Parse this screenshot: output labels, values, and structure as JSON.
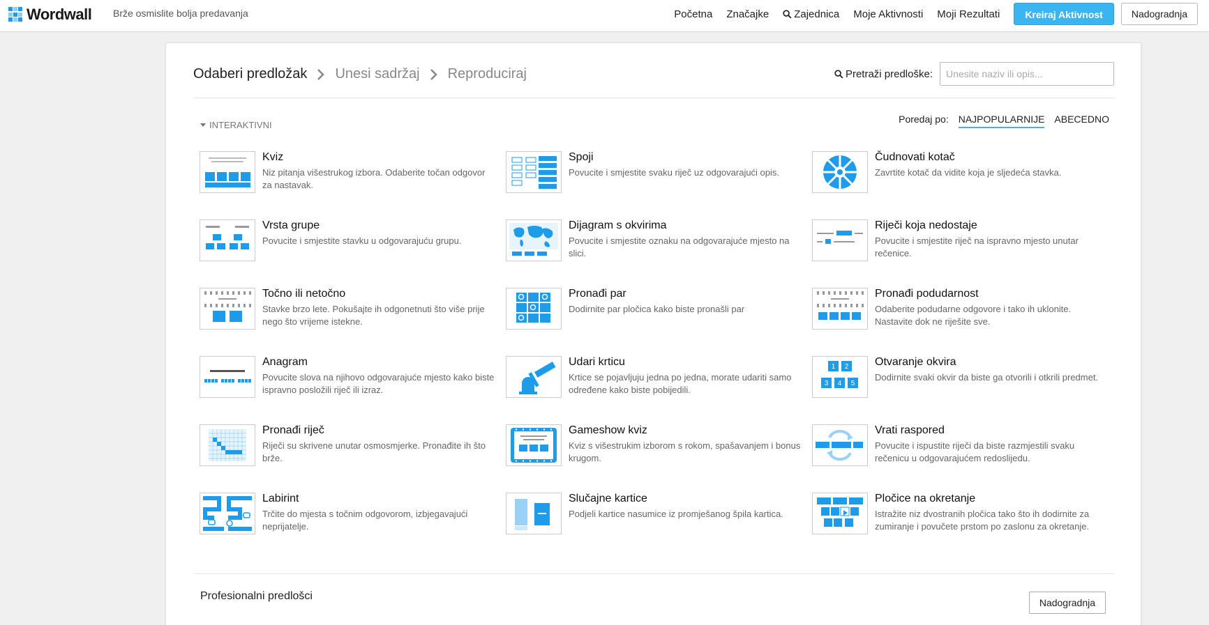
{
  "header": {
    "logo_text": "Wordwall",
    "tagline": "Brže osmislite bolja predavanja",
    "nav": {
      "home": "Početna",
      "features": "Značajke",
      "community": "Zajednica",
      "my_activities": "Moje Aktivnosti",
      "my_results": "Moji Rezultati"
    },
    "create_button": "Kreiraj Aktivnost",
    "upgrade_button": "Nadogradnja"
  },
  "breadcrumb": {
    "step1": "Odaberi predložak",
    "step2": "Unesi sadržaj",
    "step3": "Reproduciraj"
  },
  "search": {
    "label": "Pretraži predloške:",
    "placeholder": "Unesite naziv ili opis...",
    "value": ""
  },
  "section": {
    "label": "INTERAKTIVNI"
  },
  "sort": {
    "label": "Poredaj po:",
    "popular": "NAJPOPULARNIJE",
    "alpha": "ABECEDNO",
    "selected": "NAJPOPULARNIJE"
  },
  "templates": [
    {
      "name": "Kviz",
      "desc": "Niz pitanja višestrukog izbora. Odaberite točan odgovor za nastavak.",
      "icon": "quiz-thumb"
    },
    {
      "name": "Spoji",
      "desc": "Povucite i smjestite svaku riječ uz odgovarajući opis.",
      "icon": "match-thumb"
    },
    {
      "name": "Čudnovati kotač",
      "desc": "Zavrtite kotač da vidite koja je sljedeća stavka.",
      "icon": "wheel-thumb"
    },
    {
      "name": "Vrsta grupe",
      "desc": "Povucite i smjestite stavku u odgovarajuću grupu.",
      "icon": "group-sort-thumb"
    },
    {
      "name": "Dijagram s okvirima",
      "desc": "Povucite i smjestite oznaku na odgovarajuće mjesto na slici.",
      "icon": "labelled-diagram-thumb"
    },
    {
      "name": "Riječi koja nedostaje",
      "desc": "Povucite i smjestite riječ na ispravno mjesto unutar rečenice.",
      "icon": "missing-word-thumb"
    },
    {
      "name": "Točno ili netočno",
      "desc": "Stavke brzo lete. Pokušajte ih odgonetnuti što više prije nego što vrijeme istekne.",
      "icon": "true-false-thumb"
    },
    {
      "name": "Pronađi par",
      "desc": "Dodirnite par pločica kako biste pronašli par",
      "icon": "matching-pairs-thumb"
    },
    {
      "name": "Pronađi podudarnost",
      "desc": "Odaberite podudarne odgovore i tako ih uklonite. Nastavite dok ne riješite sve.",
      "icon": "find-match-thumb"
    },
    {
      "name": "Anagram",
      "desc": "Povucite slova na njihovo odgovarajuće mjesto kako biste ispravno posložili riječ ili izraz.",
      "icon": "anagram-thumb"
    },
    {
      "name": "Udari krticu",
      "desc": "Krtice se pojavljuju jedna po jedna, morate udariti samo određene kako biste pobijedili.",
      "icon": "whack-a-mole-thumb"
    },
    {
      "name": "Otvaranje okvira",
      "desc": "Dodirnite svaki okvir da biste ga otvorili i otkrili predmet.",
      "icon": "open-box-thumb"
    },
    {
      "name": "Pronađi riječ",
      "desc": "Riječi su skrivene unutar osmosmjerke. Pronađite ih što brže.",
      "icon": "wordsearch-thumb"
    },
    {
      "name": "Gameshow kviz",
      "desc": "Kviz s višestrukim izborom s rokom, spašavanjem i bonus krugom.",
      "icon": "gameshow-thumb"
    },
    {
      "name": "Vrati raspored",
      "desc": "Povucite i ispustite riječi da biste razmjestili svaku rečenicu u odgovarajućem redoslijedu.",
      "icon": "unjumble-thumb"
    },
    {
      "name": "Labirint",
      "desc": "Trčite do mjesta s točnim odgovorom, izbjegavajući neprijatelje.",
      "icon": "maze-thumb"
    },
    {
      "name": "Slučajne kartice",
      "desc": "Podjeli kartice nasumice iz promješanog špila kartica.",
      "icon": "random-cards-thumb"
    },
    {
      "name": "Pločice na okretanje",
      "desc": "Istražite niz dvostranih pločica tako što ih dodirnite za zumiranje i povučete prstom po zaslonu za okretanje.",
      "icon": "flip-tiles-thumb"
    }
  ],
  "pro": {
    "label": "Profesionalni predlošci",
    "button": "Nadogradnja"
  },
  "colors": {
    "accent": "#3bb4f2",
    "tile": "#1e9be9"
  }
}
